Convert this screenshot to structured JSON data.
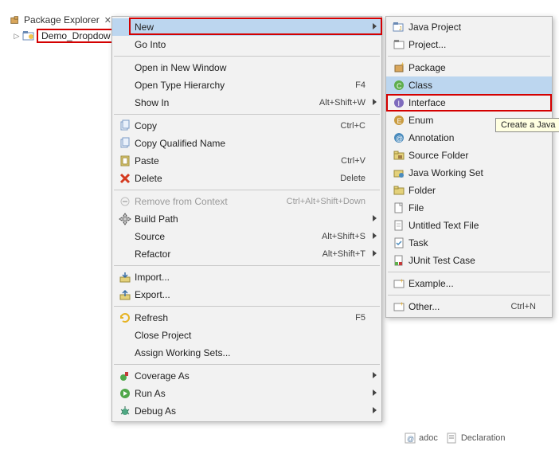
{
  "view": {
    "title": "Package Explorer"
  },
  "tree": {
    "items": [
      {
        "label": "Demo_Dropdow"
      }
    ]
  },
  "context_menu": {
    "items": [
      {
        "label": "New",
        "accel": "",
        "submenu": true,
        "selected": true,
        "highlighted": true
      },
      {
        "label": "Go Into"
      },
      {
        "sep": true
      },
      {
        "label": "Open in New Window"
      },
      {
        "label": "Open Type Hierarchy",
        "accel": "F4"
      },
      {
        "label": "Show In",
        "accel": "Alt+Shift+W",
        "submenu": true
      },
      {
        "sep": true
      },
      {
        "label": "Copy",
        "accel": "Ctrl+C",
        "icon": "copy-icon"
      },
      {
        "label": "Copy Qualified Name",
        "icon": "copy-qual-icon"
      },
      {
        "label": "Paste",
        "accel": "Ctrl+V",
        "icon": "paste-icon"
      },
      {
        "label": "Delete",
        "accel": "Delete",
        "icon": "delete-icon"
      },
      {
        "sep": true
      },
      {
        "label": "Remove from Context",
        "accel": "Ctrl+Alt+Shift+Down",
        "icon": "remove-context-icon",
        "disabled": true
      },
      {
        "label": "Build Path",
        "submenu": true,
        "icon": "move-cursor-icon"
      },
      {
        "label": "Source",
        "accel": "Alt+Shift+S",
        "submenu": true
      },
      {
        "label": "Refactor",
        "accel": "Alt+Shift+T",
        "submenu": true
      },
      {
        "sep": true
      },
      {
        "label": "Import...",
        "icon": "import-icon"
      },
      {
        "label": "Export...",
        "icon": "export-icon"
      },
      {
        "sep": true
      },
      {
        "label": "Refresh",
        "accel": "F5",
        "icon": "refresh-icon"
      },
      {
        "label": "Close Project"
      },
      {
        "label": "Assign Working Sets..."
      },
      {
        "sep": true
      },
      {
        "label": "Coverage As",
        "submenu": true,
        "icon": "coverage-icon"
      },
      {
        "label": "Run As",
        "submenu": true,
        "icon": "run-icon"
      },
      {
        "label": "Debug As",
        "submenu": true,
        "icon": "debug-icon"
      }
    ]
  },
  "submenu_new": {
    "items": [
      {
        "label": "Java Project",
        "icon": "java-project-icon"
      },
      {
        "label": "Project...",
        "icon": "project-icon"
      },
      {
        "sep": true
      },
      {
        "label": "Package",
        "icon": "package-new-icon"
      },
      {
        "label": "Class",
        "icon": "class-icon",
        "selected": true,
        "highlighted": true
      },
      {
        "label": "Interface",
        "icon": "interface-icon"
      },
      {
        "label": "Enum",
        "icon": "enum-icon"
      },
      {
        "label": "Annotation",
        "icon": "annotation-icon"
      },
      {
        "label": "Source Folder",
        "icon": "source-folder-icon"
      },
      {
        "label": "Java Working Set",
        "icon": "working-set-icon"
      },
      {
        "label": "Folder",
        "icon": "folder-icon"
      },
      {
        "label": "File",
        "icon": "file-icon"
      },
      {
        "label": "Untitled Text File",
        "icon": "untitled-file-icon"
      },
      {
        "label": "Task",
        "icon": "task-icon"
      },
      {
        "label": "JUnit Test Case",
        "icon": "junit-icon"
      },
      {
        "sep": true
      },
      {
        "label": "Example...",
        "icon": "example-icon"
      },
      {
        "sep": true
      },
      {
        "label": "Other...",
        "accel": "Ctrl+N",
        "icon": "other-icon"
      }
    ]
  },
  "tooltip": {
    "text": "Create a Java"
  },
  "bottom_tabs": {
    "items": [
      {
        "label": "adoc",
        "icon": "javadoc-icon"
      },
      {
        "label": "Declaration",
        "icon": "declaration-icon"
      }
    ]
  }
}
